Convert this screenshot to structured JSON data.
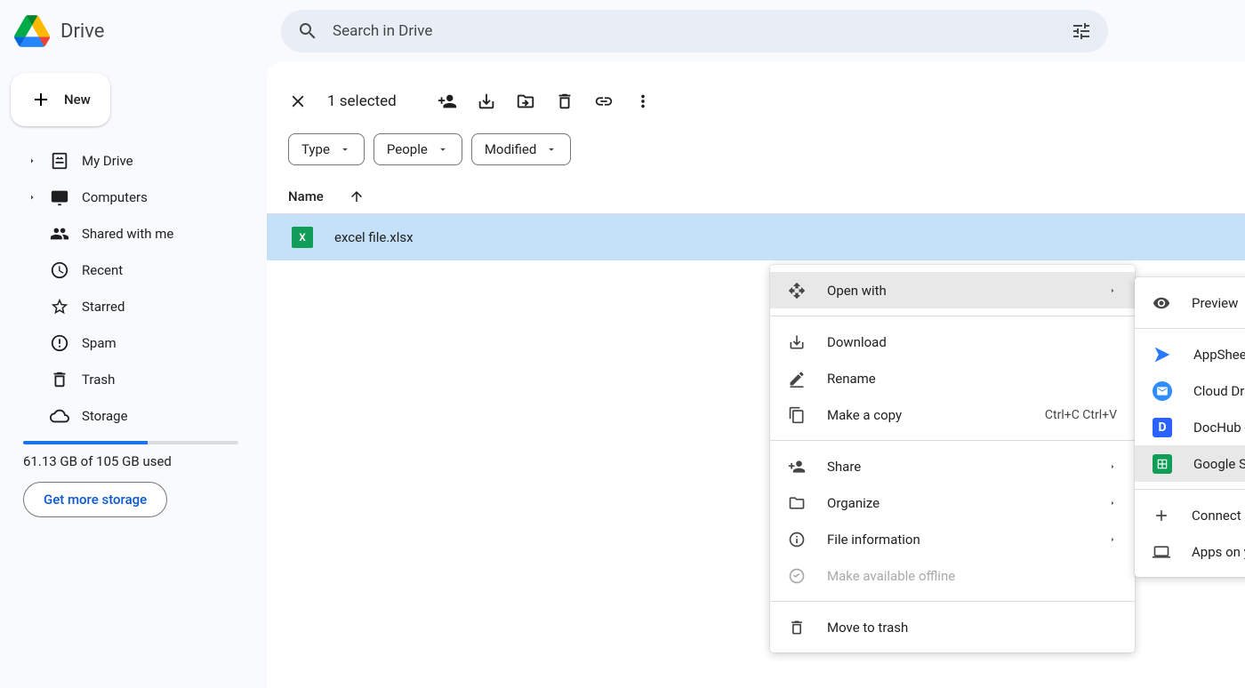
{
  "app": {
    "title": "Drive"
  },
  "search": {
    "placeholder": "Search in Drive"
  },
  "sidebar": {
    "new_label": "New",
    "items": [
      {
        "label": "My Drive"
      },
      {
        "label": "Computers"
      },
      {
        "label": "Shared with me"
      },
      {
        "label": "Recent"
      },
      {
        "label": "Starred"
      },
      {
        "label": "Spam"
      },
      {
        "label": "Trash"
      },
      {
        "label": "Storage"
      }
    ],
    "storage_text": "61.13 GB of 105 GB used",
    "storage_btn": "Get more storage"
  },
  "toolbar": {
    "selected": "1 selected"
  },
  "filters": {
    "type": "Type",
    "people": "People",
    "modified": "Modified"
  },
  "columns": {
    "name": "Name"
  },
  "file": {
    "name": "excel file.xlsx",
    "icon_text": "X"
  },
  "context_menu": {
    "open_with": "Open with",
    "download": "Download",
    "rename": "Rename",
    "make_copy": "Make a copy",
    "make_copy_shortcut": "Ctrl+C Ctrl+V",
    "share": "Share",
    "organize": "Organize",
    "file_info": "File information",
    "offline": "Make available offline",
    "trash": "Move to trash"
  },
  "submenu": {
    "preview": "Preview",
    "appsheet": "AppSheet",
    "clouddrive": "Cloud Drive to Mail",
    "dochub": "DocHub - PDF Sign and Edit",
    "gsheets": "Google Sheets",
    "connect": "Connect more apps",
    "computer": "Apps on your computer"
  }
}
